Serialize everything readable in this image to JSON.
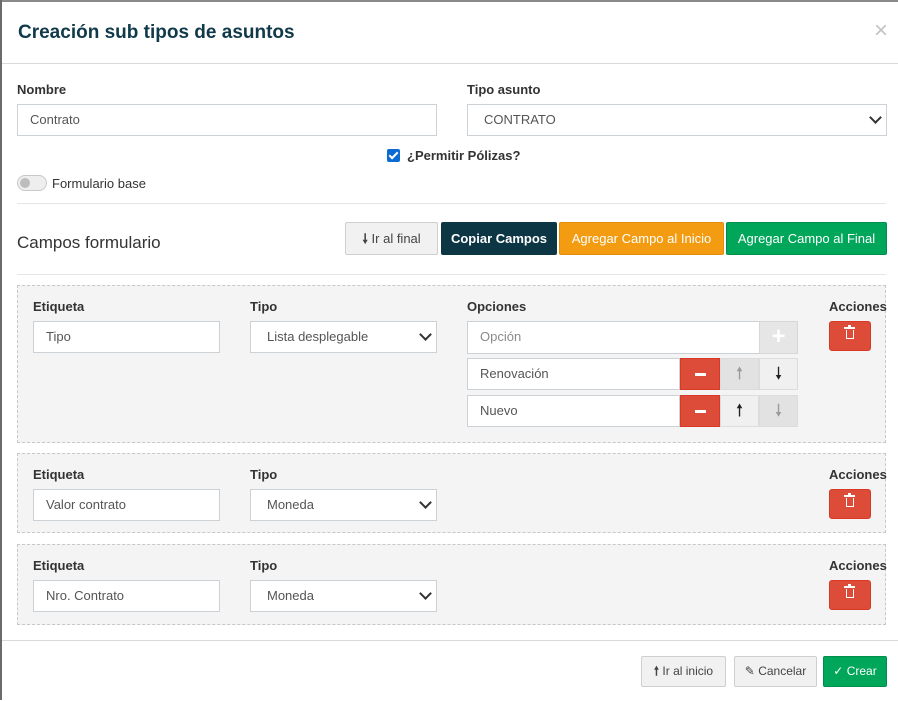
{
  "modal": {
    "title": "Creación sub tipos de asuntos",
    "close_symbol": "×"
  },
  "form": {
    "nombre_label": "Nombre",
    "nombre_value": "Contrato",
    "tipo_asunto_label": "Tipo asunto",
    "tipo_asunto_value": "CONTRATO",
    "permitir_polizas_label": "¿Permitir Pólizas?",
    "permitir_polizas_checked": true,
    "formulario_base_label": "Formulario base",
    "formulario_base_on": false
  },
  "campos": {
    "section_title": "Campos formulario",
    "buttons": {
      "ir_final": "Ir al final",
      "copiar": "Copiar Campos",
      "agregar_inicio": "Agregar Campo al Inicio",
      "agregar_final": "Agregar Campo al Final"
    },
    "labels": {
      "etiqueta": "Etiqueta",
      "tipo": "Tipo",
      "opciones": "Opciones",
      "acciones": "Acciones"
    },
    "fields": [
      {
        "etiqueta": "Tipo",
        "tipo": "Lista desplegable",
        "option_placeholder": "Opción",
        "options": [
          "Renovación",
          "Nuevo"
        ]
      },
      {
        "etiqueta": "Valor contrato",
        "tipo": "Moneda"
      },
      {
        "etiqueta": "Nro. Contrato",
        "tipo": "Moneda"
      }
    ]
  },
  "footer": {
    "ir_inicio": "Ir al inicio",
    "cancelar": "Cancelar",
    "crear": "Crear"
  },
  "colors": {
    "title": "#10394a",
    "dark_button": "#0d3645",
    "orange": "#f39c12",
    "green": "#00a65a",
    "red": "#dd4b39",
    "checkbox": "#0b6bd3"
  },
  "icons": [
    "close-icon",
    "arrow-down-icon",
    "arrow-up-icon",
    "trash-icon",
    "plus-icon",
    "minus-icon",
    "eraser-icon",
    "check-icon",
    "chevron-down-icon"
  ]
}
